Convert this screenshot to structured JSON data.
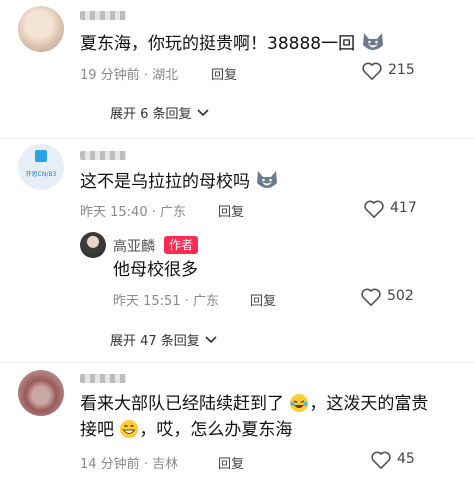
{
  "comments": [
    {
      "text": "夏东海，你玩的挺贵啊！38888一回",
      "time": "19 分钟前",
      "location": "湖北",
      "reply_label": "回复",
      "likes": "215",
      "expand_label": "展开 6 条回复"
    },
    {
      "avatar_text": "开思CN/B3",
      "text": "这不是乌拉拉的母校吗",
      "time": "昨天 15:40",
      "location": "广东",
      "reply_label": "回复",
      "likes": "417",
      "reply": {
        "author": "高亚麟",
        "author_badge": "作者",
        "text": "他母校很多",
        "time": "昨天 15:51",
        "location": "广东",
        "reply_label": "回复",
        "likes": "502"
      },
      "expand_label": "展开 47 条回复"
    },
    {
      "text_line1": "看来大部队已经陆续赶到了",
      "text_line1b": "，这泼天的富贵",
      "text_line2a": "接吧",
      "text_line2b": "，哎，怎么办夏东海",
      "time": "14 分钟前",
      "location": "吉林",
      "reply_label": "回复",
      "likes": "45"
    }
  ],
  "meta_separator": " · ",
  "colors": {
    "badge_bg": "#fe2c55",
    "meta_text": "#8a8a8a"
  }
}
